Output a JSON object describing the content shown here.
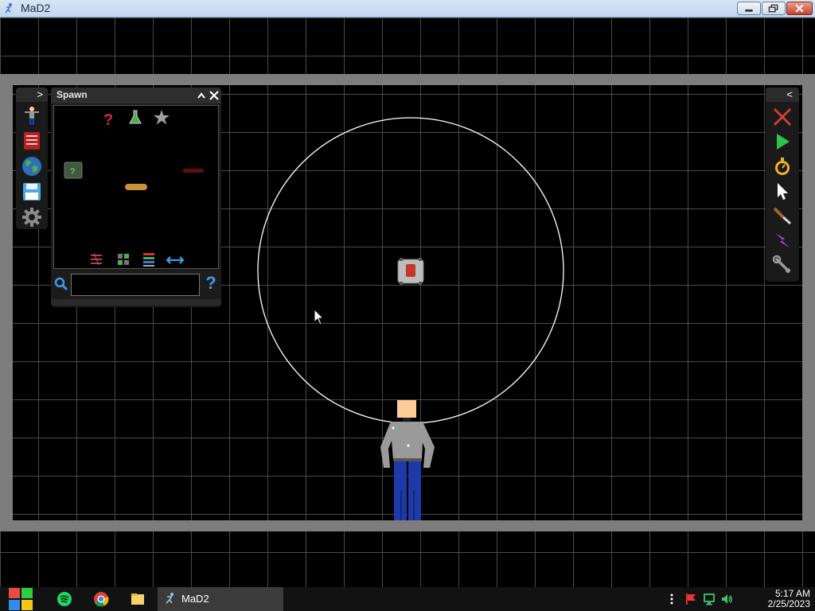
{
  "window": {
    "title": "MaD2",
    "controls": {
      "minimize": "minimize",
      "maximize": "maximize",
      "close": "close"
    }
  },
  "left_toolbar": {
    "expand_glyph": ">",
    "tools": [
      "person-icon",
      "book-icon",
      "globe-icon",
      "save-icon",
      "gear-icon"
    ]
  },
  "spawn_panel": {
    "title": "Spawn",
    "collapse_glyph": "^",
    "close_glyph": "✕",
    "search": {
      "value": "",
      "placeholder": ""
    },
    "help_glyph": "?"
  },
  "right_toolbar": {
    "collapse_glyph": "<",
    "tools": [
      "delete-x-icon",
      "play-icon",
      "stopwatch-icon",
      "cursor-icon",
      "knife-icon",
      "lightning-icon",
      "wrench-icon"
    ]
  },
  "colors": {
    "grid_line": "#4a4a4a",
    "wall": "#7d7d7d",
    "skin": "#ffcc99",
    "shirt": "#9a9a9a",
    "pants": "#1e3aa8",
    "circle": "#ffffff"
  },
  "taskbar": {
    "app_label": "MaD2",
    "time": "5:17 AM",
    "date": "2/25/2023"
  }
}
